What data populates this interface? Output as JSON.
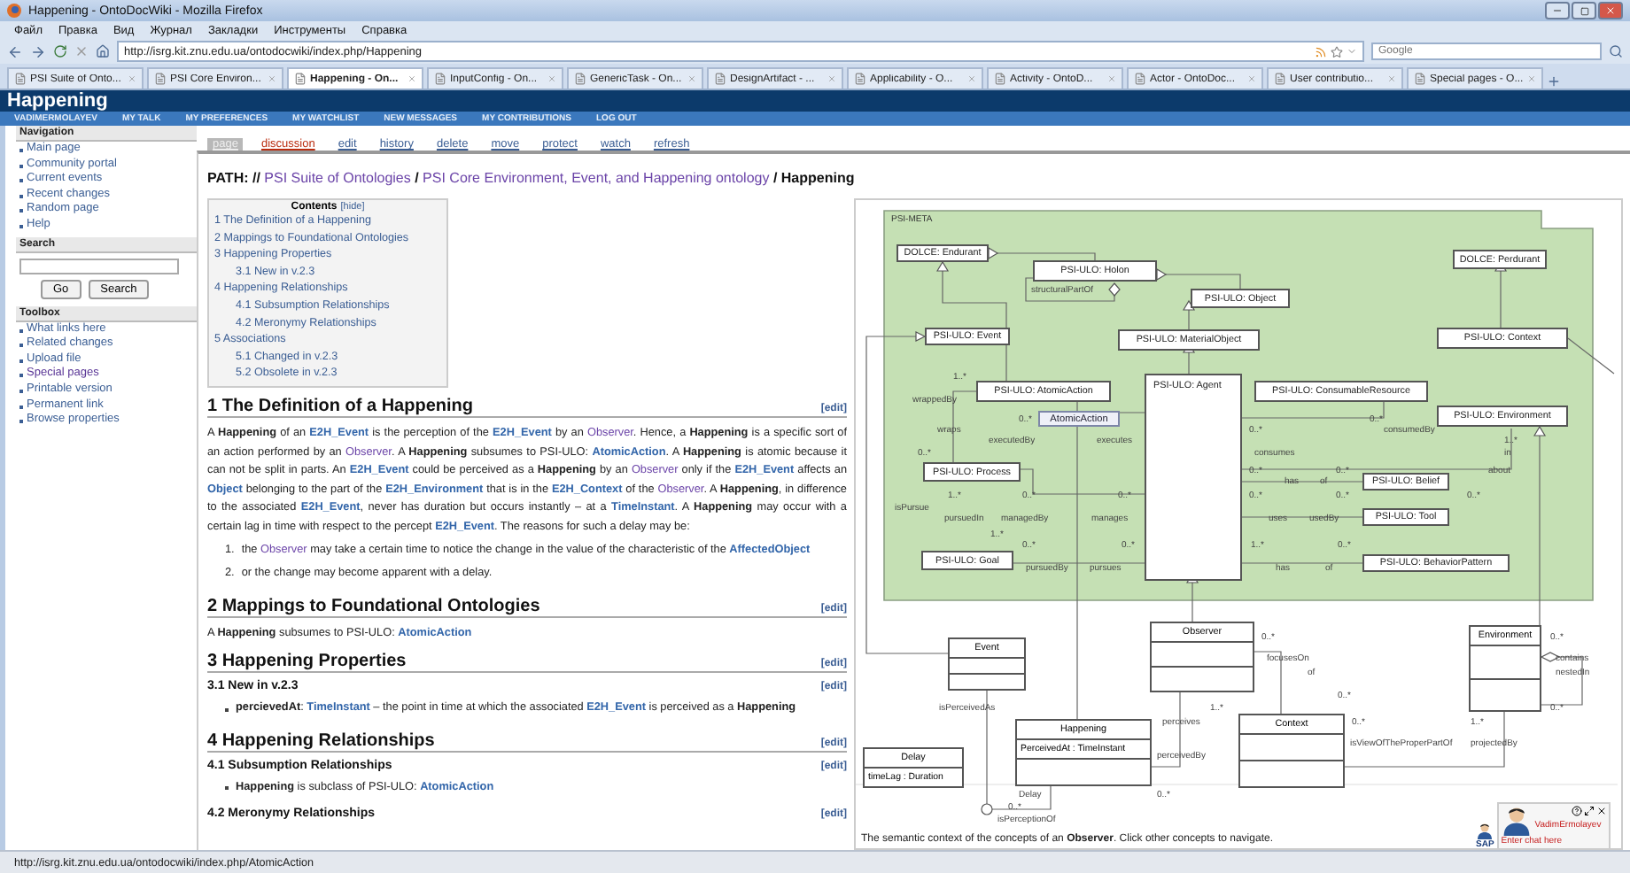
{
  "window": {
    "title": "Happening - OntoDocWiki - Mozilla Firefox"
  },
  "menu": [
    "Файл",
    "Правка",
    "Вид",
    "Журнал",
    "Закладки",
    "Инструменты",
    "Справка"
  ],
  "address_bar": {
    "url": "http://isrg.kit.znu.edu.ua/ontodocwiki/index.php/Happening"
  },
  "web_search": {
    "placeholder": "Google"
  },
  "tabs": [
    {
      "label": "PSI Suite of Onto...",
      "selected": false
    },
    {
      "label": "PSI Core Environ...",
      "selected": false
    },
    {
      "label": "Happening - On...",
      "selected": true
    },
    {
      "label": "InputConfig - On...",
      "selected": false
    },
    {
      "label": "GenericTask - On...",
      "selected": false
    },
    {
      "label": "DesignArtifact - ...",
      "selected": false
    },
    {
      "label": "Applicability - O...",
      "selected": false
    },
    {
      "label": "Activity - OntoD...",
      "selected": false
    },
    {
      "label": "Actor - OntoDoc...",
      "selected": false
    },
    {
      "label": "User contributio...",
      "selected": false
    },
    {
      "label": "Special pages - O...",
      "selected": false
    }
  ],
  "site_title": "Happening",
  "user_links": [
    "VADIMERMOLAYEV",
    "MY TALK",
    "MY PREFERENCES",
    "MY WATCHLIST",
    "NEW MESSAGES",
    "MY CONTRIBUTIONS",
    "LOG OUT"
  ],
  "sidebar": [
    {
      "title": "Navigation",
      "kind": "links",
      "items": [
        {
          "label": "Main page",
          "visited": false
        },
        {
          "label": "Community portal",
          "visited": false
        },
        {
          "label": "Current events",
          "visited": false
        },
        {
          "label": "Recent changes",
          "visited": false
        },
        {
          "label": "Random page",
          "visited": false
        },
        {
          "label": "Help",
          "visited": false
        }
      ]
    },
    {
      "title": "Search",
      "kind": "search",
      "buttons": [
        "Go",
        "Search"
      ]
    },
    {
      "title": "Toolbox",
      "kind": "links",
      "items": [
        {
          "label": "What links here",
          "visited": false
        },
        {
          "label": "Related changes",
          "visited": false
        },
        {
          "label": "Upload file",
          "visited": false
        },
        {
          "label": "Special pages",
          "visited": true
        },
        {
          "label": "Printable version",
          "visited": false
        },
        {
          "label": "Permanent link",
          "visited": false
        },
        {
          "label": "Browse properties",
          "visited": false
        }
      ]
    }
  ],
  "page_tabs": [
    {
      "label": "page",
      "selected": true,
      "missing": false
    },
    {
      "label": "discussion",
      "selected": false,
      "missing": true
    },
    {
      "label": "edit",
      "selected": false,
      "missing": false
    },
    {
      "label": "history",
      "selected": false,
      "missing": false
    },
    {
      "label": "delete",
      "selected": false,
      "missing": false
    },
    {
      "label": "move",
      "selected": false,
      "missing": false
    },
    {
      "label": "protect",
      "selected": false,
      "missing": false
    },
    {
      "label": "watch",
      "selected": false,
      "missing": false
    },
    {
      "label": "refresh",
      "selected": false,
      "missing": false
    }
  ],
  "path": [
    {
      "text": "PATH: // ",
      "kind": "plain"
    },
    {
      "text": "PSI Suite of Ontologies",
      "kind": "visited"
    },
    {
      "text": " / ",
      "kind": "plain"
    },
    {
      "text": "PSI Core Environment, Event, and Happening ontology",
      "kind": "visited"
    },
    {
      "text": " / Happening",
      "kind": "plain"
    }
  ],
  "toc": {
    "title": "Contents",
    "toggle": "[hide]",
    "entries": [
      {
        "label": "1 The Definition of a Happening"
      },
      {
        "label": "2 Mappings to Foundational Ontologies"
      },
      {
        "label": "3 Happening Properties",
        "children": [
          {
            "label": "3.1 New in v.2.3"
          }
        ]
      },
      {
        "label": "4 Happening Relationships",
        "children": [
          {
            "label": "4.1 Subsumption Relationships"
          },
          {
            "label": "4.2 Meronymy Relationships"
          }
        ]
      },
      {
        "label": "5 Associations",
        "children": [
          {
            "label": "5.1 Changed in v.2.3"
          },
          {
            "label": "5.2 Obsolete in v.2.3"
          }
        ]
      }
    ]
  },
  "sections": [
    {
      "kind": "h2",
      "title": "1 The Definition of a Happening",
      "edit": "[edit]"
    },
    {
      "kind": "paragraph",
      "segments": [
        {
          "text": "A ",
          "kind": "plain"
        },
        {
          "text": "Happening",
          "kind": "bold"
        },
        {
          "text": " of an ",
          "kind": "plain"
        },
        {
          "text": "E2H_Event",
          "kind": "link"
        },
        {
          "text": " is the perception of the ",
          "kind": "plain"
        },
        {
          "text": "E2H_Event",
          "kind": "link"
        },
        {
          "text": " by an ",
          "kind": "plain"
        },
        {
          "text": "Observer",
          "kind": "visited"
        },
        {
          "text": ". Hence, a ",
          "kind": "plain"
        },
        {
          "text": "Happening",
          "kind": "bold"
        },
        {
          "text": " is a specific sort of an action performed by an ",
          "kind": "plain"
        },
        {
          "text": "Observer",
          "kind": "visited"
        },
        {
          "text": ". A ",
          "kind": "plain"
        },
        {
          "text": "Happening",
          "kind": "bold"
        },
        {
          "text": " subsumes to PSI-ULO: ",
          "kind": "plain"
        },
        {
          "text": "AtomicAction",
          "kind": "link"
        },
        {
          "text": ". A ",
          "kind": "plain"
        },
        {
          "text": "Happening",
          "kind": "bold"
        },
        {
          "text": " is atomic because it can not be split in parts. An ",
          "kind": "plain"
        },
        {
          "text": "E2H_Event",
          "kind": "link"
        },
        {
          "text": " could be perceived as a ",
          "kind": "plain"
        },
        {
          "text": "Happening",
          "kind": "bold"
        },
        {
          "text": " by an ",
          "kind": "plain"
        },
        {
          "text": "Observer",
          "kind": "visited"
        },
        {
          "text": " only if the ",
          "kind": "plain"
        },
        {
          "text": "E2H_Event",
          "kind": "link"
        },
        {
          "text": " affects an ",
          "kind": "plain"
        },
        {
          "text": "Object",
          "kind": "link"
        },
        {
          "text": " belonging to the part of the ",
          "kind": "plain"
        },
        {
          "text": "E2H_Environment",
          "kind": "link"
        },
        {
          "text": " that is in the ",
          "kind": "plain"
        },
        {
          "text": "E2H_Context",
          "kind": "link"
        },
        {
          "text": " of the ",
          "kind": "plain"
        },
        {
          "text": "Observer",
          "kind": "visited"
        },
        {
          "text": ". A ",
          "kind": "plain"
        },
        {
          "text": "Happening",
          "kind": "bold"
        },
        {
          "text": ", in difference to the associated ",
          "kind": "plain"
        },
        {
          "text": "E2H_Event",
          "kind": "link"
        },
        {
          "text": ", never has duration but occurs instantly – at a ",
          "kind": "plain"
        },
        {
          "text": "TimeInstant",
          "kind": "link"
        },
        {
          "text": ". A ",
          "kind": "plain"
        },
        {
          "text": "Happening",
          "kind": "bold"
        },
        {
          "text": " may occur with a certain lag in time with respect to the percept ",
          "kind": "plain"
        },
        {
          "text": "E2H_Event",
          "kind": "link"
        },
        {
          "text": ". The reasons for such a delay may be:",
          "kind": "plain"
        }
      ]
    },
    {
      "kind": "ordered_list",
      "items": [
        {
          "number": "1.",
          "segments": [
            {
              "text": "the ",
              "kind": "plain"
            },
            {
              "text": "Observer",
              "kind": "visited"
            },
            {
              "text": " may take a certain time to notice the change in the value of the characteristic of the ",
              "kind": "plain"
            },
            {
              "text": "AffectedObject",
              "kind": "link"
            }
          ]
        },
        {
          "number": "2.",
          "segments": [
            {
              "text": "or the change may become apparent with a delay.",
              "kind": "plain"
            }
          ]
        }
      ]
    },
    {
      "kind": "h2",
      "title": "2 Mappings to Foundational Ontologies",
      "edit": "[edit]"
    },
    {
      "kind": "paragraph",
      "segments": [
        {
          "text": "A ",
          "kind": "plain"
        },
        {
          "text": "Happening",
          "kind": "bold"
        },
        {
          "text": " subsumes to PSI-ULO: ",
          "kind": "plain"
        },
        {
          "text": "AtomicAction",
          "kind": "link"
        }
      ]
    },
    {
      "kind": "h2",
      "title": "3 Happening Properties",
      "edit": "[edit]"
    },
    {
      "kind": "h3",
      "title": "3.1 New in v.2.3",
      "edit": "[edit]"
    },
    {
      "kind": "bullet_list",
      "items": [
        {
          "segments": [
            {
              "text": "percievedAt",
              "kind": "bold"
            },
            {
              "text": ": ",
              "kind": "plain"
            },
            {
              "text": "TimeInstant",
              "kind": "link"
            },
            {
              "text": " – the point in time at which the associated ",
              "kind": "plain"
            },
            {
              "text": "E2H_Event",
              "kind": "link"
            },
            {
              "text": " is perceived as a ",
              "kind": "plain"
            },
            {
              "text": "Happening",
              "kind": "bold"
            }
          ]
        }
      ]
    },
    {
      "kind": "h2",
      "title": "4 Happening Relationships",
      "edit": "[edit]"
    },
    {
      "kind": "h3",
      "title": "4.1 Subsumption Relationships",
      "edit": "[edit]"
    },
    {
      "kind": "bullet_list",
      "items": [
        {
          "segments": [
            {
              "text": "Happening",
              "kind": "bold"
            },
            {
              "text": " is subclass of PSI-ULO: ",
              "kind": "plain"
            },
            {
              "text": "AtomicAction",
              "kind": "link"
            }
          ]
        }
      ]
    },
    {
      "kind": "h3",
      "title": "4.2 Meronymy Relationships",
      "edit": "[edit]"
    }
  ],
  "diagram": {
    "package": "PSI-META",
    "nodes": [
      {
        "label": "DOLCE: Endurant",
        "kind": "concept"
      },
      {
        "label": "PSI-ULO: Holon",
        "kind": "concept"
      },
      {
        "label": "PSI-ULO: Object",
        "kind": "concept"
      },
      {
        "label": "DOLCE: Perdurant",
        "kind": "concept"
      },
      {
        "label": "PSI-ULO: Event",
        "kind": "concept"
      },
      {
        "label": "PSI-ULO: MaterialObject",
        "kind": "concept"
      },
      {
        "label": "PSI-ULO: Context",
        "kind": "concept"
      },
      {
        "label": "PSI-ULO: AtomicAction",
        "kind": "concept"
      },
      {
        "label": "PSI-ULO: Agent",
        "kind": "tall"
      },
      {
        "label": "PSI-ULO: ConsumableResource",
        "kind": "concept"
      },
      {
        "label": "PSI-ULO: Environment",
        "kind": "concept"
      },
      {
        "label": "PSI-ULO: Process",
        "kind": "concept"
      },
      {
        "label": "PSI-ULO: Belief",
        "kind": "concept"
      },
      {
        "label": "PSI-ULO: Tool",
        "kind": "concept"
      },
      {
        "label": "PSI-ULO: Goal",
        "kind": "concept"
      },
      {
        "label": "PSI-ULO: BehaviorPattern",
        "kind": "concept"
      },
      {
        "label": "Observer",
        "kind": "class"
      },
      {
        "label": "Event",
        "kind": "class"
      },
      {
        "label": "Environment",
        "kind": "class"
      },
      {
        "label": "Happening",
        "kind": "class",
        "attribute": "PerceivedAt : TimeInstant"
      },
      {
        "label": "Context",
        "kind": "class"
      },
      {
        "label": "Delay",
        "kind": "class",
        "attribute": "timeLag : Duration"
      },
      {
        "label": "AtomicAction",
        "kind": "tooltip"
      }
    ],
    "labels": [
      "structuralPartOf",
      "1..*",
      "wrappedBy",
      "0..*",
      "0..*",
      "wraps",
      "0..*",
      "consumedBy",
      "executedBy",
      "executes",
      "1..*",
      "0..*",
      "consumes",
      "in",
      "0..*",
      "0..*",
      "about",
      "has",
      "of",
      "1..*",
      "0..*",
      "0..*",
      "0..*",
      "0..*",
      "0..*",
      "isPursue",
      "pursuedIn",
      "managedBy",
      "manages",
      "uses",
      "usedBy",
      "1..*",
      "0..*",
      "0..*",
      "1..*",
      "0..*",
      "pursuedBy",
      "pursues",
      "has",
      "of",
      "0..*",
      "0..*",
      "focusesOn",
      "contains",
      "of",
      "nestedIn",
      "0..*",
      "isPerceivedAs",
      "1..*",
      "0..*",
      "perceives",
      "0..*",
      "1..*",
      "isViewOfTheProperPartOf",
      "projectedBy",
      "perceivedBy",
      "Delay",
      "0..*",
      "0..*",
      "isPerceptionOf"
    ],
    "caption": "The semantic context of the concepts of an **Observer**. Click other concepts to navigate."
  },
  "chat": {
    "badge": "SAP",
    "user": "VadimErmolayev",
    "placeholder": "Enter chat here"
  },
  "status_bar": {
    "text": "http://isrg.kit.znu.edu.ua/ontodocwiki/index.php/AtomicAction"
  }
}
